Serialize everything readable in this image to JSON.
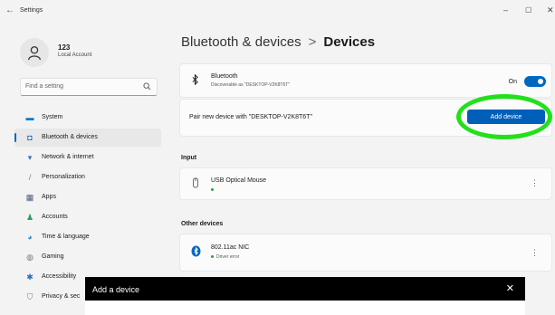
{
  "window": {
    "title": "Settings",
    "back": "←",
    "minimize": "–",
    "maximize": "▢",
    "close": "✕"
  },
  "profile": {
    "name": "123",
    "sub": "Local Account"
  },
  "search": {
    "placeholder": "Find a setting"
  },
  "sidebar": {
    "items": [
      {
        "label": "System",
        "icon": "system-icon",
        "color": "#0078d4"
      },
      {
        "label": "Bluetooth & devices",
        "icon": "bluetooth-devices-icon",
        "color": "#0067c0",
        "active": true
      },
      {
        "label": "Network & internet",
        "icon": "network-icon",
        "color": "#2b74c7"
      },
      {
        "label": "Personalization",
        "icon": "brush-icon",
        "color": "#d46a1e"
      },
      {
        "label": "Apps",
        "icon": "apps-icon",
        "color": "#4a5a7a"
      },
      {
        "label": "Accounts",
        "icon": "accounts-icon",
        "color": "#2e9e5a"
      },
      {
        "label": "Time & language",
        "icon": "time-language-icon",
        "color": "#2a8bd0"
      },
      {
        "label": "Gaming",
        "icon": "gaming-icon",
        "color": "#777777"
      },
      {
        "label": "Accessibility",
        "icon": "accessibility-icon",
        "color": "#1e6fd1"
      },
      {
        "label": "Privacy & sec",
        "icon": "shield-icon",
        "color": "#6a7a8a"
      }
    ]
  },
  "breadcrumb": {
    "parent": "Bluetooth & devices",
    "separator": ">",
    "current": "Devices"
  },
  "bluetooth": {
    "title": "Bluetooth",
    "subtitle": "Discoverable as \"DESKTOP-V2K8T6T\"",
    "toggle_label": "On"
  },
  "pair": {
    "text": "Pair new device with \"DESKTOP-V2K8T6T\"",
    "button": "Add device"
  },
  "input_section": {
    "label": "Input",
    "devices": [
      {
        "name": "USB Optical Mouse",
        "status": "",
        "status_color": "#2e9e3a"
      }
    ]
  },
  "other_section": {
    "label": "Other devices",
    "devices": [
      {
        "name": "802.11ac NIC",
        "status": "Driver error",
        "status_color": "#2e9e3a"
      }
    ]
  },
  "more_icon": "⋮",
  "dialog": {
    "title": "Add a device",
    "close": "✕"
  },
  "colors": {
    "accent": "#0067c0",
    "highlight": "#22e01c"
  }
}
